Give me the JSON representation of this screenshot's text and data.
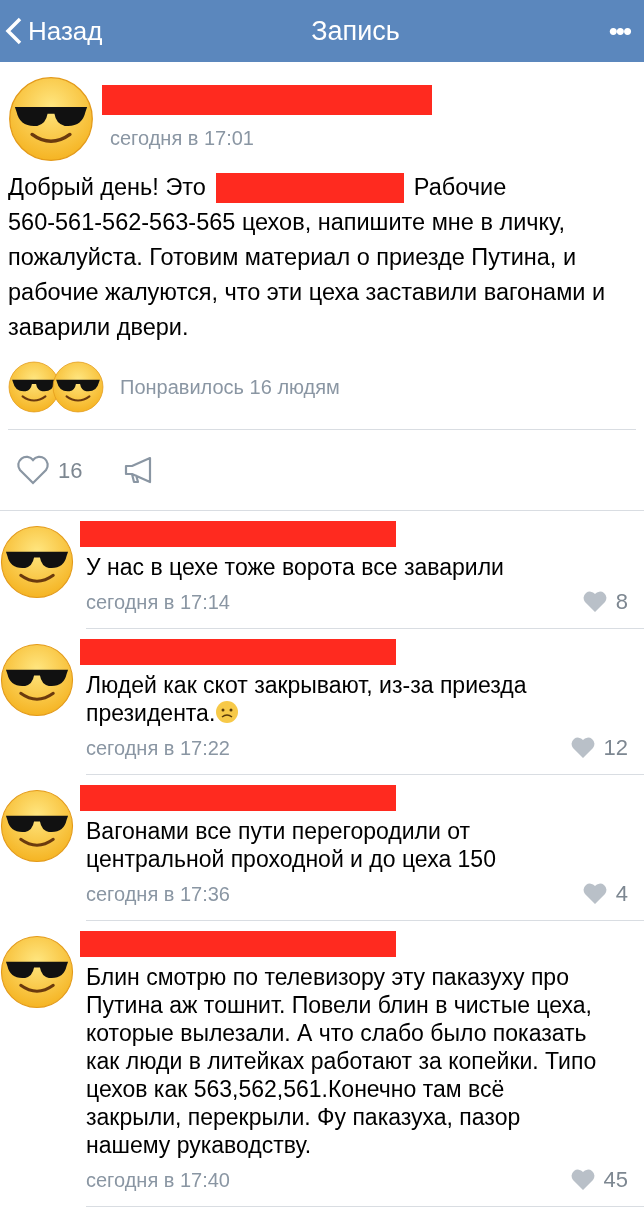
{
  "nav_bar": {
    "back_label": "Назад",
    "title": "Запись",
    "more": "•••"
  },
  "post": {
    "author_redacted": true,
    "time": "сегодня в 17:01",
    "text_parts": [
      {
        "kind": "text",
        "text": "Добрый день! Это"
      },
      {
        "kind": "redaction"
      },
      {
        "kind": "text",
        "text": "Рабочие"
      },
      {
        "kind": "paragraph",
        "text": "560-561-562-563-565 цехов, напишите мне в личку, пожалуйста. Готовим материал о приезде Путина, и рабочие жалуются, что эти цеха заставили вагонами и заварили двери."
      }
    ],
    "liked_by": "Понравилось 16 людям",
    "like_count": "16"
  },
  "comments": [
    {
      "author_redacted": true,
      "text": "У нас в цехе тоже ворота все заварили",
      "sad_emoji": false,
      "time": "сегодня в 17:14",
      "likes": "8"
    },
    {
      "author_redacted": true,
      "text": "Людей как скот закрывают, из-за приезда президента.",
      "sad_emoji": true,
      "time": "сегодня в 17:22",
      "likes": "12"
    },
    {
      "author_redacted": true,
      "text": "Вагонами все пути перегородили от центральной проходной и до цеха 150",
      "sad_emoji": false,
      "time": "сегодня в 17:36",
      "likes": "4"
    },
    {
      "author_redacted": true,
      "text": "Блин смотрю по телевизору эту паказуху про Путина аж тошнит. Повели блин в чистые цеха, которые вылезали. А что слабо было показать как люди в литейках работают за копейки. Типо цехов как 563,562,561.Конечно там всё закрыли, перекрыли. Фу паказуха, пазор нашему рукаводству.",
      "sad_emoji": false,
      "time": "сегодня в 17:40",
      "likes": "45"
    }
  ]
}
